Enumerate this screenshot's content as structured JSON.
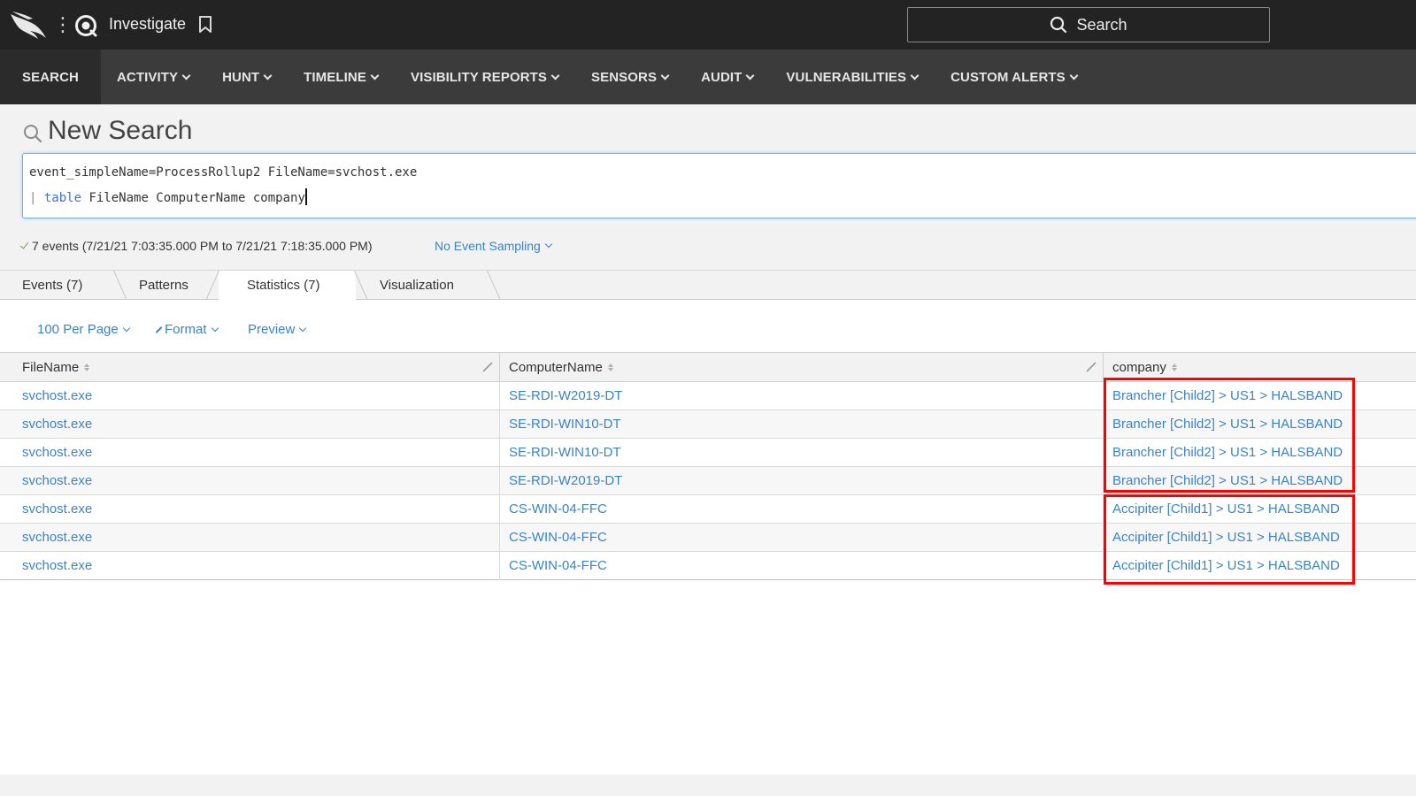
{
  "topbar": {
    "app_title": "Investigate",
    "search_label": "Search"
  },
  "nav": {
    "items": [
      {
        "label": "SEARCH",
        "has_menu": false,
        "active": true
      },
      {
        "label": "ACTIVITY",
        "has_menu": true
      },
      {
        "label": "HUNT",
        "has_menu": true
      },
      {
        "label": "TIMELINE",
        "has_menu": true
      },
      {
        "label": "VISIBILITY REPORTS",
        "has_menu": true
      },
      {
        "label": "SENSORS",
        "has_menu": true
      },
      {
        "label": "AUDIT",
        "has_menu": true
      },
      {
        "label": "VULNERABILITIES",
        "has_menu": true
      },
      {
        "label": "CUSTOM ALERTS",
        "has_menu": true
      }
    ]
  },
  "search": {
    "title": "New Search",
    "query_line1": "event_simpleName=ProcessRollup2 FileName=svchost.exe",
    "query_pipe": "| ",
    "query_keyword": "table",
    "query_rest": " FileName ComputerName company",
    "events_summary": "7 events (7/21/21 7:03:35.000 PM to 7/21/21 7:18:35.000 PM)",
    "sampling": "No Event Sampling"
  },
  "tabs": [
    {
      "label": "Events (7)"
    },
    {
      "label": "Patterns"
    },
    {
      "label": "Statistics (7)",
      "active": true
    },
    {
      "label": "Visualization"
    }
  ],
  "toolbar": {
    "per_page": "100 Per Page",
    "format": "Format",
    "preview": "Preview"
  },
  "table": {
    "columns": [
      "FileName",
      "ComputerName",
      "company"
    ],
    "rows": [
      [
        "svchost.exe",
        "SE-RDI-W2019-DT",
        "Brancher [Child2] > US1 > HALSBAND"
      ],
      [
        "svchost.exe",
        "SE-RDI-WIN10-DT",
        "Brancher [Child2] > US1 > HALSBAND"
      ],
      [
        "svchost.exe",
        "SE-RDI-WIN10-DT",
        "Brancher [Child2] > US1 > HALSBAND"
      ],
      [
        "svchost.exe",
        "SE-RDI-W2019-DT",
        "Brancher [Child2] > US1 > HALSBAND"
      ],
      [
        "svchost.exe",
        "CS-WIN-04-FFC",
        "Accipiter [Child1] > US1 > HALSBAND"
      ],
      [
        "svchost.exe",
        "CS-WIN-04-FFC",
        "Accipiter [Child1] > US1 > HALSBAND"
      ],
      [
        "svchost.exe",
        "CS-WIN-04-FFC",
        "Accipiter [Child1] > US1 > HALSBAND"
      ]
    ]
  },
  "colors": {
    "topbar": "#232323",
    "navbar": "#3b3b3b",
    "link": "#3a83c6",
    "highlight": "#ff0000"
  }
}
